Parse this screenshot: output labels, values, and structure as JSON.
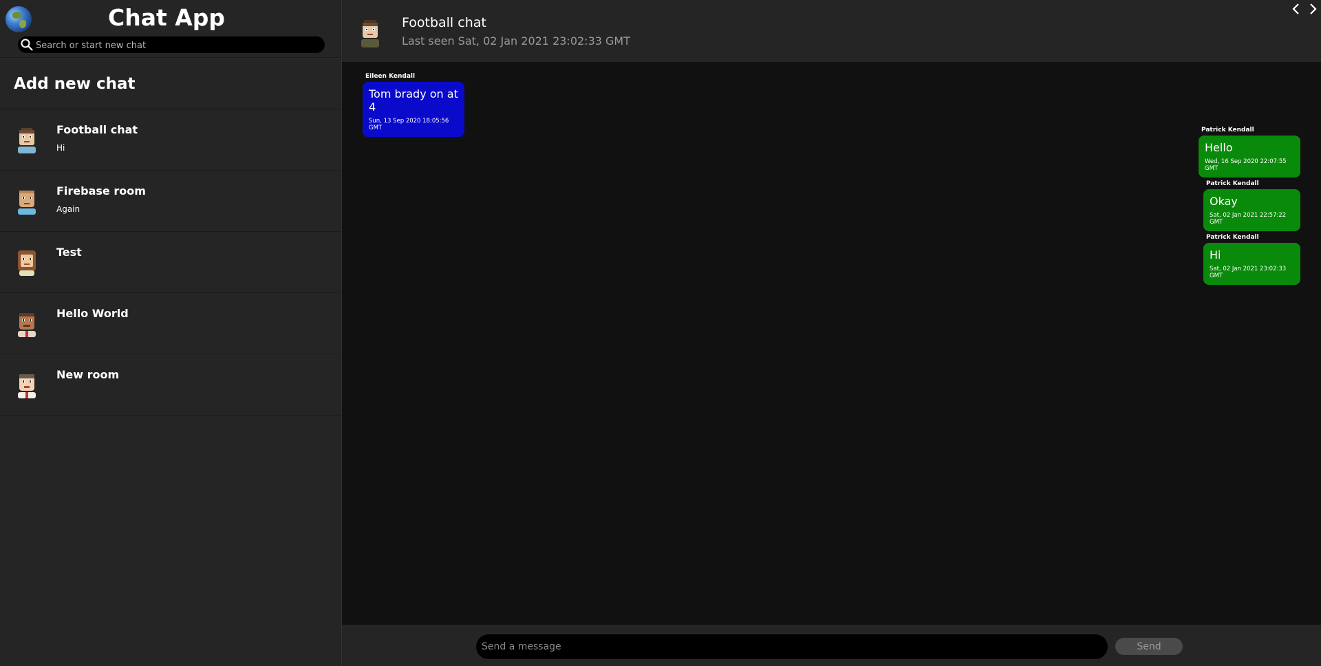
{
  "app": {
    "title": "Chat App",
    "logo_icon": "globe-icon"
  },
  "search": {
    "placeholder": "Search or start new chat",
    "value": ""
  },
  "sidebar": {
    "add_chat_label": "Add new chat",
    "rooms": [
      {
        "name": "Football chat",
        "last_message": "Hi"
      },
      {
        "name": "Firebase room",
        "last_message": "Again"
      },
      {
        "name": "Test",
        "last_message": ""
      },
      {
        "name": "Hello World",
        "last_message": ""
      },
      {
        "name": "New room",
        "last_message": ""
      }
    ]
  },
  "chat_header": {
    "title": "Football chat",
    "last_seen": "Last seen Sat, 02 Jan 2021 23:02:33 GMT"
  },
  "nav": {
    "back_icon": "chevron-left-icon",
    "forward_icon": "chevron-right-icon"
  },
  "messages": [
    {
      "sender": "Eileen Kendall",
      "text": "Tom brady on at 4",
      "time": "Sun, 13 Sep 2020 18:05:56 GMT",
      "side": "received",
      "color": "#0a0acb"
    },
    {
      "sender": "Patrick Kendall",
      "text": "Hello",
      "time": "Wed, 16 Sep 2020 22:07:55 GMT",
      "side": "sent",
      "color": "#0a8a0a"
    },
    {
      "sender": "Patrick Kendall",
      "text": "Okay",
      "time": "Sat, 02 Jan 2021 22:57:22 GMT",
      "side": "sent",
      "color": "#0a8a0a"
    },
    {
      "sender": "Patrick Kendall",
      "text": "Hi",
      "time": "Sat, 02 Jan 2021 23:02:33 GMT",
      "side": "sent",
      "color": "#0a8a0a"
    }
  ],
  "composer": {
    "placeholder": "Send a message",
    "value": "",
    "send_label": "Send"
  }
}
